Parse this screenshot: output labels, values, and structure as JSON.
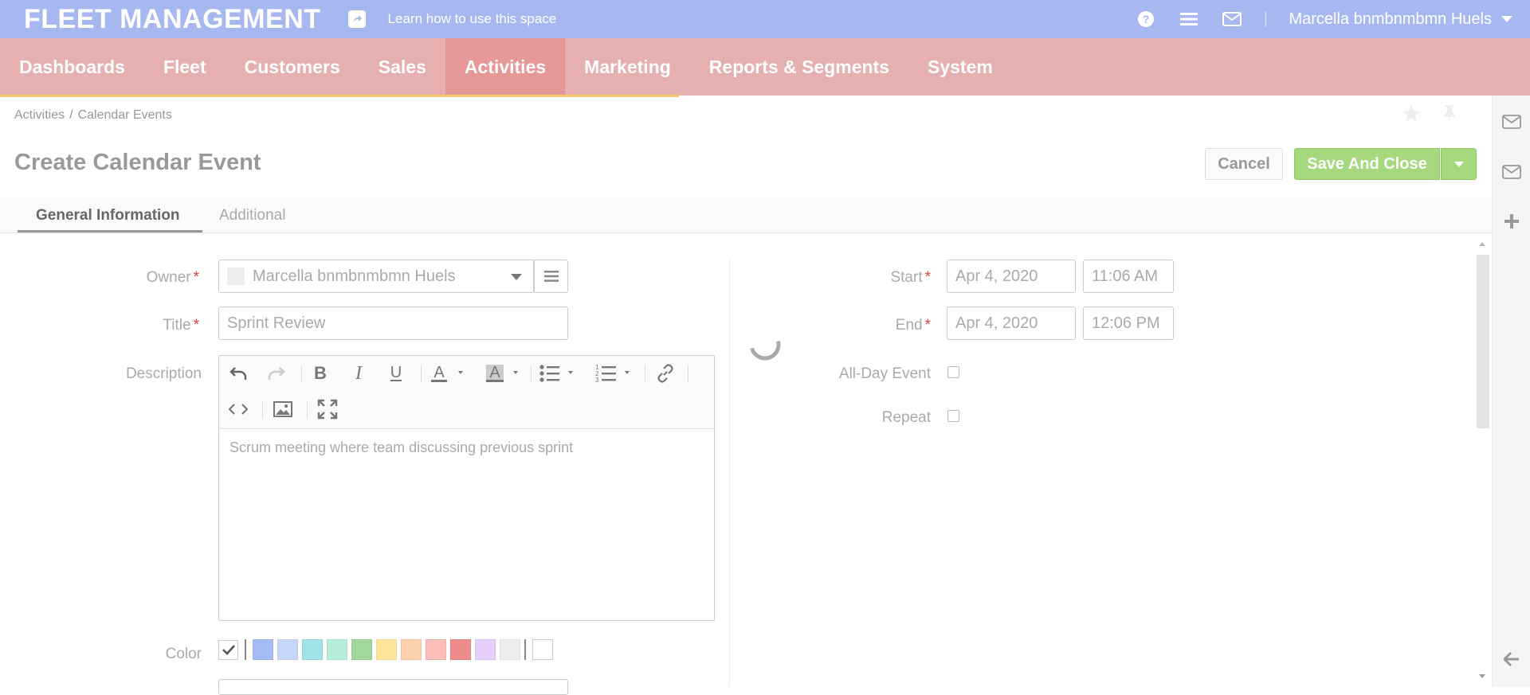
{
  "app": {
    "brand": "FLEET MANAGEMENT",
    "learn_link": "Learn how to use this space",
    "user_name": "Marcella bnmbnmbmn Huels"
  },
  "nav": {
    "items": [
      "Dashboards",
      "Fleet",
      "Customers",
      "Sales",
      "Activities",
      "Marketing",
      "Reports & Segments",
      "System"
    ],
    "active": "Activities"
  },
  "breadcrumb": {
    "parent": "Activities",
    "separator": "/",
    "current": "Calendar Events"
  },
  "page": {
    "title": "Create Calendar Event",
    "cancel_label": "Cancel",
    "save_label": "Save And Close"
  },
  "tabs": {
    "general": "General Information",
    "additional": "Additional"
  },
  "form": {
    "owner_label": "Owner",
    "owner_value": "Marcella bnmbnmbmn Huels",
    "title_label": "Title",
    "title_value": "Sprint Review",
    "description_label": "Description",
    "description_value": "Scrum meeting where team discussing previous sprint",
    "color_label": "Color",
    "required_mark": "*",
    "start_label": "Start",
    "start_date": "Apr 4, 2020",
    "start_time": "11:06 AM",
    "end_label": "End",
    "end_date": "Apr 4, 2020",
    "end_time": "12:06 PM",
    "allday_label": "All-Day Event",
    "repeat_label": "Repeat"
  },
  "colors": {
    "swatches": [
      "#a4bdf5",
      "#c6d6fa",
      "#a0e4e6",
      "#b6ecda",
      "#9fd898",
      "#fce49b",
      "#fdd2af",
      "#fbbdb7",
      "#ec8a8c",
      "#e6cffa",
      "#eeeeee"
    ],
    "topbar": "#a7b7ef",
    "nav": "#e6b0b1",
    "nav_active": "#e69899",
    "save_button": "#a6d87e"
  }
}
